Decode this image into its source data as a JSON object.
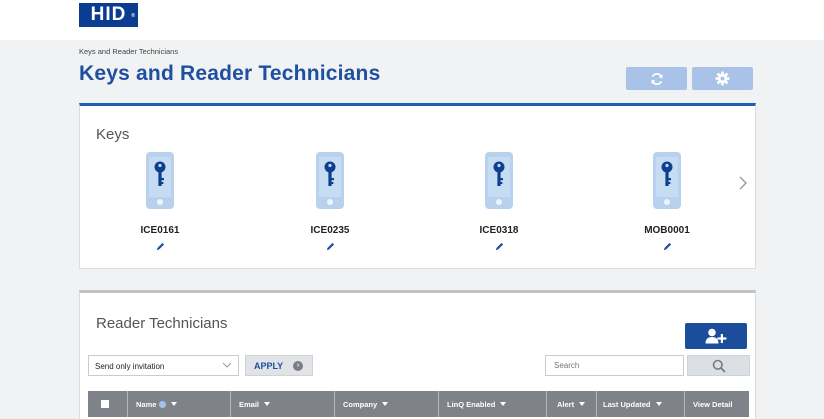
{
  "brand": {
    "logo_text": "HID",
    "color": "#0a3d91"
  },
  "breadcrumb": "Keys and Reader Technicians",
  "page_title": "Keys and Reader Technicians",
  "header_buttons": [
    {
      "icon": "refresh-icon"
    },
    {
      "icon": "gear-icon"
    }
  ],
  "keys": {
    "title": "Keys",
    "items": [
      {
        "id": "ICE0161",
        "icon": "phone-key-icon"
      },
      {
        "id": "ICE0235",
        "icon": "phone-key-icon"
      },
      {
        "id": "ICE0318",
        "icon": "phone-key-icon"
      },
      {
        "id": "MOB0001",
        "icon": "phone-key-icon"
      }
    ],
    "next_icon": "chevron-right-icon"
  },
  "technicians": {
    "title": "Reader Technicians",
    "add_icon": "add-user-icon",
    "select_value": "Send only invitation",
    "apply_label": "APPLY",
    "search_placeholder": "Search",
    "columns": [
      "Name",
      "Email",
      "Company",
      "LinQ Enabled",
      "Alert",
      "Last Updated",
      "View Detail"
    ]
  },
  "colors": {
    "accent": "#1f4fa0",
    "header_button": "#a9c3e8",
    "table_header": "#7f8389"
  }
}
